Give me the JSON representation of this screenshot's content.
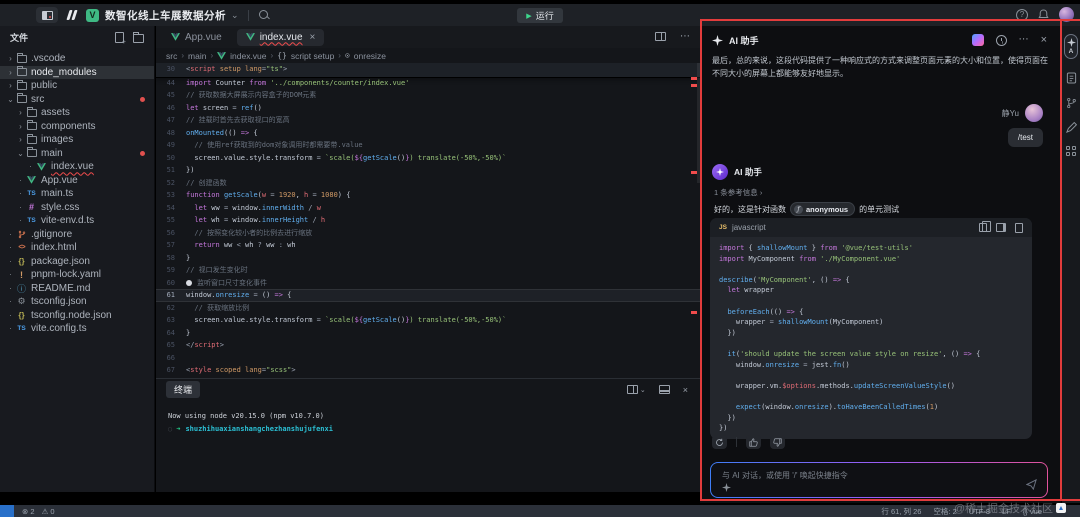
{
  "topbar": {
    "title": "数智化线上车展数据分析",
    "run_label": "运行",
    "icons": [
      "sidebar-toggle-icon",
      "marscode-logo",
      "vue-project-icon",
      "chevron-down-icon",
      "search-icon",
      "help-icon",
      "bell-icon",
      "avatar"
    ]
  },
  "sidebar": {
    "header": "文件",
    "header_icons": [
      "new-file-icon",
      "new-folder-icon"
    ],
    "items": [
      {
        "label": ".vscode",
        "icon": "folder-icon",
        "level": 0,
        "expanded": false
      },
      {
        "label": "node_modules",
        "icon": "folder-icon",
        "level": 0,
        "expanded": false,
        "selected": true
      },
      {
        "label": "public",
        "icon": "folder-icon",
        "level": 0,
        "expanded": false
      },
      {
        "label": "src",
        "icon": "folder-icon",
        "level": 0,
        "expanded": true,
        "modified": true
      },
      {
        "label": "assets",
        "icon": "folder-icon",
        "level": 1,
        "expanded": false
      },
      {
        "label": "components",
        "icon": "folder-icon",
        "level": 1,
        "expanded": false
      },
      {
        "label": "images",
        "icon": "folder-icon",
        "level": 1,
        "expanded": false
      },
      {
        "label": "main",
        "icon": "folder-icon",
        "level": 1,
        "expanded": true,
        "modified": true
      },
      {
        "label": "index.vue",
        "icon": "vue-file-icon",
        "level": 2,
        "error": true
      },
      {
        "label": "App.vue",
        "icon": "vue-file-icon",
        "level": 1
      },
      {
        "label": "main.ts",
        "icon": "ts-file-icon",
        "level": 1
      },
      {
        "label": "style.css",
        "icon": "css-file-icon",
        "level": 1
      },
      {
        "label": "vite-env.d.ts",
        "icon": "ts-file-icon",
        "level": 1
      },
      {
        "label": ".gitignore",
        "icon": "git-file-icon",
        "level": 0
      },
      {
        "label": "index.html",
        "icon": "html-file-icon",
        "level": 0
      },
      {
        "label": "package.json",
        "icon": "json-file-icon",
        "level": 0
      },
      {
        "label": "pnpm-lock.yaml",
        "icon": "yaml-file-icon",
        "level": 0
      },
      {
        "label": "README.md",
        "icon": "md-file-icon",
        "level": 0
      },
      {
        "label": "tsconfig.json",
        "icon": "gear-file-icon",
        "level": 0
      },
      {
        "label": "tsconfig.node.json",
        "icon": "json-file-icon",
        "level": 0
      },
      {
        "label": "vite.config.ts",
        "icon": "ts-file-icon",
        "level": 0
      }
    ]
  },
  "editor": {
    "tabs": [
      {
        "label": "App.vue",
        "active": false
      },
      {
        "label": "index.vue",
        "active": true,
        "error": true,
        "closable": true
      }
    ],
    "breadcrumb": [
      "src",
      "main",
      "index.vue",
      "script setup",
      "onresize"
    ],
    "sticky": {
      "num": "30",
      "segments": [
        [
          "op",
          "<"
        ],
        [
          "var",
          "script"
        ],
        [
          "txt",
          " "
        ],
        [
          "num",
          "setup"
        ],
        [
          "txt",
          " "
        ],
        [
          "num",
          "lang"
        ],
        [
          "op",
          "="
        ],
        [
          "str",
          "\"ts\""
        ],
        [
          "op",
          ">"
        ]
      ]
    },
    "lines": [
      {
        "num": "44",
        "segments": [
          [
            "kw",
            "import"
          ],
          [
            "txt",
            " Counter "
          ],
          [
            "kw",
            "from"
          ],
          [
            "txt",
            " "
          ],
          [
            "str",
            "'../components/counter/index.vue'"
          ]
        ]
      },
      {
        "num": "45",
        "segments": [
          [
            "cmt",
            "// 获取数据大屏展示内容盒子的DOM元素"
          ]
        ]
      },
      {
        "num": "46",
        "segments": [
          [
            "kw",
            "let"
          ],
          [
            "txt",
            " screen "
          ],
          [
            "op",
            "="
          ],
          [
            "txt",
            " "
          ],
          [
            "fn",
            "ref"
          ],
          [
            "txt",
            "()"
          ]
        ]
      },
      {
        "num": "47",
        "segments": [
          [
            "cmt",
            "// 挂载时首先去获取视口的宽高"
          ]
        ]
      },
      {
        "num": "48",
        "segments": [
          [
            "fn",
            "onMounted"
          ],
          [
            "txt",
            "(() "
          ],
          [
            "kw",
            "=>"
          ],
          [
            "txt",
            " {"
          ]
        ]
      },
      {
        "num": "49",
        "segments": [
          [
            "cmt",
            "  // 使用ref获取到的dom对象调用时都需要带.value"
          ]
        ]
      },
      {
        "num": "50",
        "segments": [
          [
            "txt",
            "  screen.value.style.transform "
          ],
          [
            "op",
            "="
          ],
          [
            "txt",
            " "
          ],
          [
            "str",
            "`scale("
          ],
          [
            "kw",
            "${"
          ],
          [
            "fn",
            "getScale"
          ],
          [
            "txt",
            "()"
          ],
          [
            "kw",
            "}"
          ],
          [
            "str",
            ") translate(-50%,-50%)`"
          ]
        ]
      },
      {
        "num": "51",
        "segments": [
          [
            "txt",
            "})"
          ]
        ]
      },
      {
        "num": "52",
        "segments": [
          [
            "cmt",
            "// 创建函数"
          ]
        ]
      },
      {
        "num": "53",
        "segments": [
          [
            "kw",
            "function"
          ],
          [
            "txt",
            " "
          ],
          [
            "fn",
            "getScale"
          ],
          [
            "txt",
            "("
          ],
          [
            "var",
            "w"
          ],
          [
            "txt",
            " "
          ],
          [
            "op",
            "="
          ],
          [
            "txt",
            " "
          ],
          [
            "num",
            "1920"
          ],
          [
            "txt",
            ", "
          ],
          [
            "var",
            "h"
          ],
          [
            "txt",
            " "
          ],
          [
            "op",
            "="
          ],
          [
            "txt",
            " "
          ],
          [
            "num",
            "1080"
          ],
          [
            "txt",
            ") {"
          ]
        ]
      },
      {
        "num": "54",
        "segments": [
          [
            "kw",
            "  let"
          ],
          [
            "txt",
            " ww "
          ],
          [
            "op",
            "="
          ],
          [
            "txt",
            " window."
          ],
          [
            "fn",
            "innerWidth"
          ],
          [
            "txt",
            " "
          ],
          [
            "op",
            "/"
          ],
          [
            "txt",
            " "
          ],
          [
            "var",
            "w"
          ]
        ]
      },
      {
        "num": "55",
        "segments": [
          [
            "kw",
            "  let"
          ],
          [
            "txt",
            " wh "
          ],
          [
            "op",
            "="
          ],
          [
            "txt",
            " window."
          ],
          [
            "fn",
            "innerHeight"
          ],
          [
            "txt",
            " "
          ],
          [
            "op",
            "/"
          ],
          [
            "txt",
            " "
          ],
          [
            "var",
            "h"
          ]
        ]
      },
      {
        "num": "56",
        "segments": [
          [
            "cmt",
            "  // 按照变化较小者的比例去进行缩放"
          ]
        ]
      },
      {
        "num": "57",
        "segments": [
          [
            "kw",
            "  return"
          ],
          [
            "txt",
            " ww "
          ],
          [
            "op",
            "<"
          ],
          [
            "txt",
            " wh "
          ],
          [
            "op",
            "?"
          ],
          [
            "txt",
            " ww "
          ],
          [
            "op",
            ":"
          ],
          [
            "txt",
            " wh"
          ]
        ]
      },
      {
        "num": "58",
        "segments": [
          [
            "txt",
            "}"
          ]
        ]
      },
      {
        "num": "59",
        "segments": [
          [
            "cmt",
            "// 视口发生变化时"
          ]
        ]
      },
      {
        "num": "60",
        "bulb": true,
        "segments": [
          [
            "cmt",
            "监听窗口尺寸变化事件"
          ]
        ]
      },
      {
        "num": "61",
        "current": true,
        "segments": [
          [
            "txt",
            "window."
          ],
          [
            "fn",
            "onresize"
          ],
          [
            "txt",
            " "
          ],
          [
            "op",
            "="
          ],
          [
            "txt",
            " () "
          ],
          [
            "kw",
            "=>"
          ],
          [
            "txt",
            " {"
          ]
        ]
      },
      {
        "num": "62",
        "segments": [
          [
            "cmt",
            "  // 获取缩放比例"
          ]
        ]
      },
      {
        "num": "63",
        "segments": [
          [
            "txt",
            "  screen.value.style.transform "
          ],
          [
            "op",
            "="
          ],
          [
            "txt",
            " "
          ],
          [
            "str",
            "`scale("
          ],
          [
            "kw",
            "${"
          ],
          [
            "fn",
            "getScale"
          ],
          [
            "txt",
            "()"
          ],
          [
            "kw",
            "}"
          ],
          [
            "str",
            ") translate(-50%,-50%)`"
          ]
        ]
      },
      {
        "num": "64",
        "segments": [
          [
            "txt",
            "}"
          ]
        ]
      },
      {
        "num": "65",
        "segments": [
          [
            "op",
            "</"
          ],
          [
            "var",
            "script"
          ],
          [
            "op",
            ">"
          ]
        ]
      },
      {
        "num": "66",
        "segments": []
      },
      {
        "num": "67",
        "segments": [
          [
            "op",
            "<"
          ],
          [
            "var",
            "style"
          ],
          [
            "txt",
            " "
          ],
          [
            "num",
            "scoped"
          ],
          [
            "txt",
            " "
          ],
          [
            "num",
            "lang"
          ],
          [
            "op",
            "="
          ],
          [
            "str",
            "\"scss\""
          ],
          [
            "op",
            ">"
          ]
        ]
      }
    ]
  },
  "terminal": {
    "tab": "终端",
    "info_line": "Now using node v20.15.0 (npm v10.7.0)",
    "prompt_arrow": "➜",
    "prompt_path": "shuzhihuaxianshangchezhanshujufenxi",
    "icons": [
      "split-terminal-icon",
      "panel-icon",
      "close-icon"
    ]
  },
  "ai_panel": {
    "title": "AI 助手",
    "header_icons": [
      "gradient-model-icon",
      "history-icon",
      "more-icon",
      "close-icon"
    ],
    "intro_text": "最后，总的来说，这段代码提供了一种响应式的方式来调整页面元素的大小和位置，使得页面在不同大小的屏幕上都能够友好地显示。",
    "user": {
      "name": "静Yu",
      "message": "/test"
    },
    "assistant": {
      "name": "AI 助手",
      "reference": "1 条参考信息",
      "reference_chevron": "›",
      "answer_prefix": "好的，这是针对函数",
      "function_chip": "anonymous",
      "answer_suffix": "的单元测试"
    },
    "code_block": {
      "lang_badge": "JS",
      "lang": "javascript",
      "icons": [
        "copy-icon",
        "insert-icon",
        "new-file-icon"
      ],
      "lines": [
        [
          [
            "kw",
            "import"
          ],
          [
            "txt",
            " { "
          ],
          [
            "fn",
            "shallowMount"
          ],
          [
            "txt",
            " } "
          ],
          [
            "kw",
            "from"
          ],
          [
            "txt",
            " "
          ],
          [
            "str",
            "'@vue/test-utils'"
          ]
        ],
        [
          [
            "kw",
            "import"
          ],
          [
            "txt",
            " MyComponent "
          ],
          [
            "kw",
            "from"
          ],
          [
            "txt",
            " "
          ],
          [
            "str",
            "'./MyComponent.vue'"
          ]
        ],
        [],
        [
          [
            "fn",
            "describe"
          ],
          [
            "txt",
            "("
          ],
          [
            "str",
            "'MyComponent'"
          ],
          [
            "txt",
            ", () "
          ],
          [
            "kw",
            "=>"
          ],
          [
            "txt",
            " {"
          ]
        ],
        [
          [
            "kw",
            "  let"
          ],
          [
            "txt",
            " wrapper"
          ]
        ],
        [],
        [
          [
            "txt",
            "  "
          ],
          [
            "fn",
            "beforeEach"
          ],
          [
            "txt",
            "(() "
          ],
          [
            "kw",
            "=>"
          ],
          [
            "txt",
            " {"
          ]
        ],
        [
          [
            "txt",
            "    wrapper "
          ],
          [
            "op",
            "="
          ],
          [
            "txt",
            " "
          ],
          [
            "fn",
            "shallowMount"
          ],
          [
            "txt",
            "(MyComponent)"
          ]
        ],
        [
          [
            "txt",
            "  })"
          ]
        ],
        [],
        [
          [
            "txt",
            "  "
          ],
          [
            "fn",
            "it"
          ],
          [
            "txt",
            "("
          ],
          [
            "str",
            "'should update the screen value style on resize'"
          ],
          [
            "txt",
            ", () "
          ],
          [
            "kw",
            "=>"
          ],
          [
            "txt",
            " {"
          ]
        ],
        [
          [
            "txt",
            "    window."
          ],
          [
            "fn",
            "onresize"
          ],
          [
            "txt",
            " "
          ],
          [
            "op",
            "="
          ],
          [
            "txt",
            " jest."
          ],
          [
            "fn",
            "fn"
          ],
          [
            "txt",
            "()"
          ]
        ],
        [],
        [
          [
            "txt",
            "    wrapper.vm."
          ],
          [
            "var",
            "$options"
          ],
          [
            "txt",
            ".methods."
          ],
          [
            "fn",
            "updateScreenValueStyle"
          ],
          [
            "txt",
            "()"
          ]
        ],
        [],
        [
          [
            "txt",
            "    "
          ],
          [
            "fn",
            "expect"
          ],
          [
            "txt",
            "(window."
          ],
          [
            "fn",
            "onresize"
          ],
          [
            "txt",
            ")."
          ],
          [
            "fn",
            "toHaveBeenCalledTimes"
          ],
          [
            "txt",
            "("
          ],
          [
            "num",
            "1"
          ],
          [
            "txt",
            ")"
          ]
        ],
        [
          [
            "txt",
            "  })"
          ]
        ],
        [
          [
            "txt",
            "})"
          ]
        ]
      ]
    },
    "action_icons": [
      "refresh-icon",
      "thumbs-up-icon",
      "thumbs-down-icon"
    ],
    "input": {
      "placeholder": "与 AI 对话，或使用 '/' 唤起快捷指令",
      "icons": [
        "sparkle-icon",
        "send-icon"
      ]
    }
  },
  "right_toolbar": {
    "icons": [
      "ai-assistant-icon",
      "notes-icon",
      "git-branch-icon",
      "pen-icon",
      "apps-grid-icon"
    ],
    "ai_label": "A"
  },
  "status_bar": {
    "errors": "2",
    "warnings": "0",
    "cursor": "行 61, 列 26",
    "spaces": "空格: 2",
    "encoding": "UTF-8",
    "eol": "LF",
    "lang_icon": "{}",
    "lang": "vue"
  },
  "watermark": {
    "text": "@稀土掘金技术社区"
  },
  "colors": {
    "annotation_red": "#e23c3c",
    "vue_green": "#41b883",
    "terminal_prompt_green": "#23d18b",
    "terminal_path_cyan": "#2bc0d4"
  }
}
